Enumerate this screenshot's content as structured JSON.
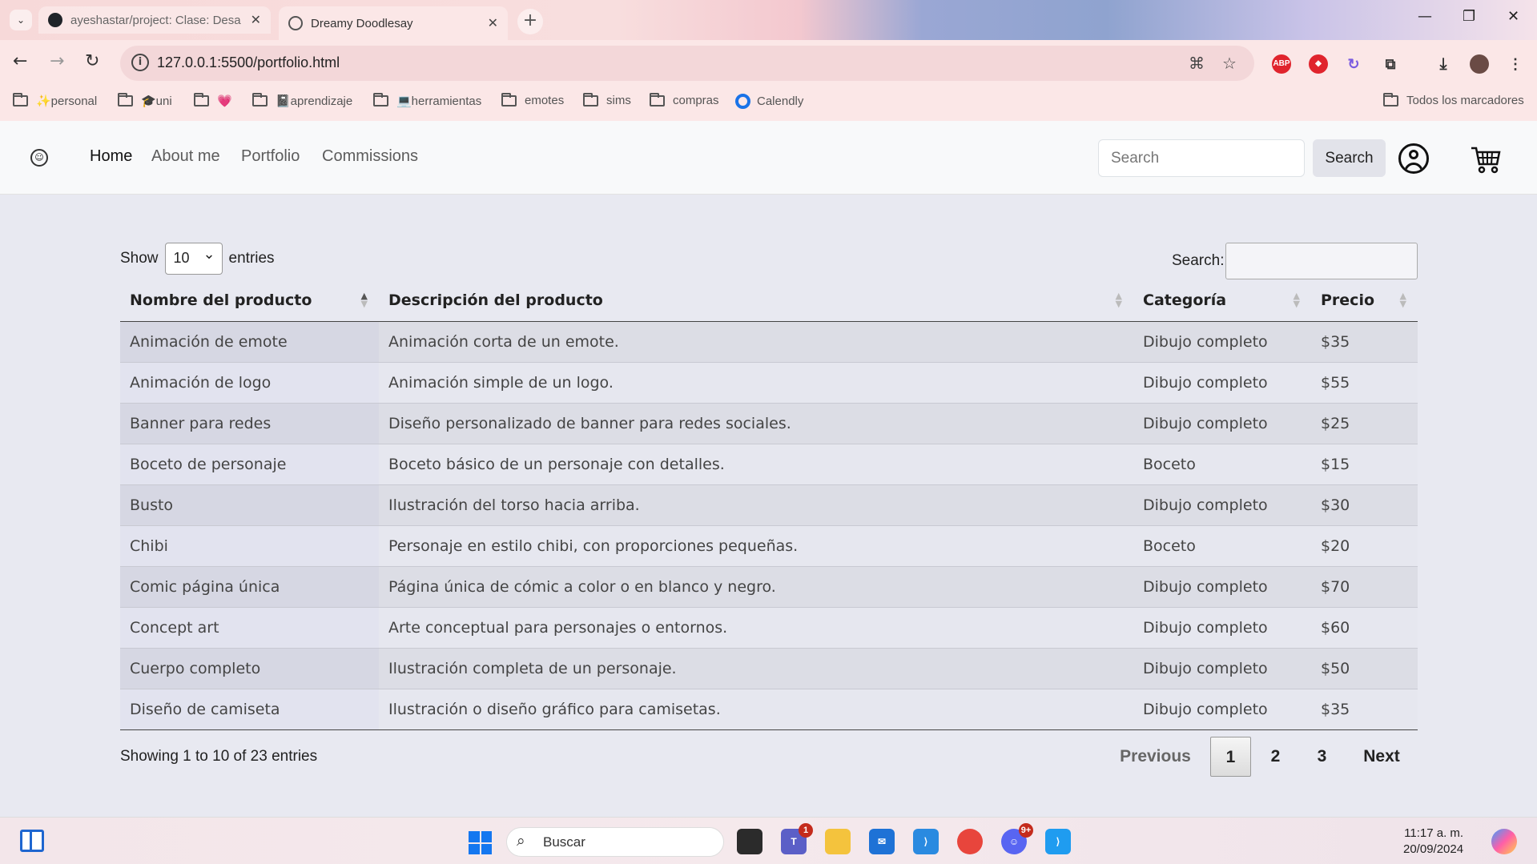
{
  "browser": {
    "tabs": [
      {
        "title": "ayeshastar/project: Clase: Desa",
        "active": false
      },
      {
        "title": "Dreamy Doodlesay",
        "active": true
      }
    ],
    "url": "127.0.0.1:5500/portfolio.html",
    "bookmarks": [
      {
        "label": "✨personal"
      },
      {
        "label": "🎓uni"
      },
      {
        "label": "💗"
      },
      {
        "label": "📓aprendizaje"
      },
      {
        "label": "💻herramientas"
      },
      {
        "label": "emotes"
      },
      {
        "label": "sims"
      },
      {
        "label": "compras"
      },
      {
        "label": "Calendly"
      }
    ],
    "all_bookmarks": "Todos los marcadores",
    "extensions": {
      "abp": "ABP"
    }
  },
  "site": {
    "nav": [
      {
        "label": "Home",
        "active": true
      },
      {
        "label": "About me"
      },
      {
        "label": "Portfolio"
      },
      {
        "label": "Commissions"
      }
    ],
    "search_placeholder": "Search",
    "search_button": "Search"
  },
  "datatable": {
    "show_label": "Show",
    "entries_label": "entries",
    "page_length": "10",
    "search_label": "Search:",
    "columns": [
      "Nombre del producto",
      "Descripción del producto",
      "Categoría",
      "Precio"
    ],
    "rows": [
      [
        "Animación de emote",
        "Animación corta de un emote.",
        "Dibujo completo",
        "$35"
      ],
      [
        "Animación de logo",
        "Animación simple de un logo.",
        "Dibujo completo",
        "$55"
      ],
      [
        "Banner para redes",
        "Diseño personalizado de banner para redes sociales.",
        "Dibujo completo",
        "$25"
      ],
      [
        "Boceto de personaje",
        "Boceto básico de un personaje con detalles.",
        "Boceto",
        "$15"
      ],
      [
        "Busto",
        "Ilustración del torso hacia arriba.",
        "Dibujo completo",
        "$30"
      ],
      [
        "Chibi",
        "Personaje en estilo chibi, con proporciones pequeñas.",
        "Boceto",
        "$20"
      ],
      [
        "Comic página única",
        "Página única de cómic a color o en blanco y negro.",
        "Dibujo completo",
        "$70"
      ],
      [
        "Concept art",
        "Arte conceptual para personajes o entornos.",
        "Dibujo completo",
        "$60"
      ],
      [
        "Cuerpo completo",
        "Ilustración completa de un personaje.",
        "Dibujo completo",
        "$50"
      ],
      [
        "Diseño de camiseta",
        "Ilustración o diseño gráfico para camisetas.",
        "Dibujo completo",
        "$35"
      ]
    ],
    "info": "Showing 1 to 10 of 23 entries",
    "pagination": {
      "previous": "Previous",
      "pages": [
        "1",
        "2",
        "3"
      ],
      "current": "1",
      "next": "Next"
    }
  },
  "taskbar": {
    "search_label": "Buscar",
    "time": "11:17 a. m.",
    "date": "20/09/2024",
    "teams_badge": "1",
    "discord_badge": "9+"
  }
}
